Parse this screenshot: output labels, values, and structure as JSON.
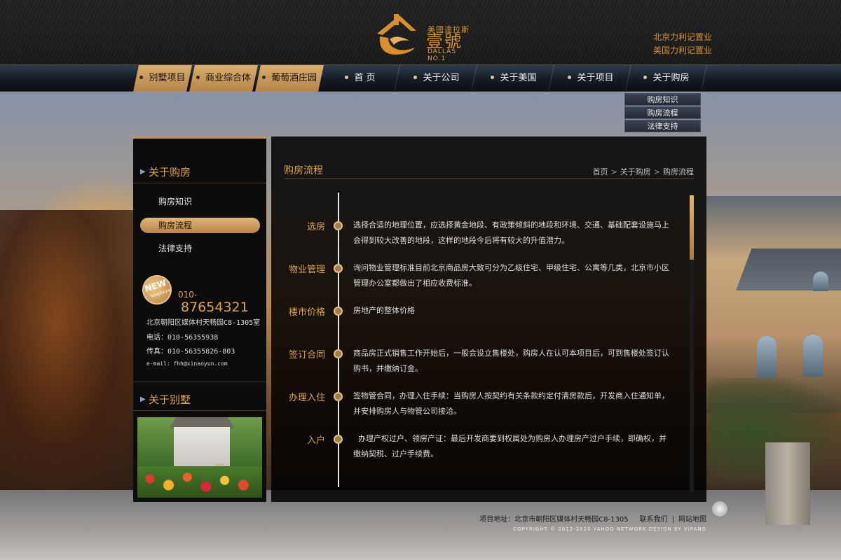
{
  "header": {
    "logo_sub": "美國達拉斯",
    "logo_main": "壹號",
    "logo_en": "DALLAS NO.1",
    "links": [
      "北京力利记置业",
      "美国力利记置业"
    ]
  },
  "nav": {
    "items": [
      "别墅项目",
      "商业综合体",
      "葡萄酒庄园",
      "首 页",
      "关于公司",
      "关于美国",
      "关于项目",
      "关于购房"
    ]
  },
  "dropdown": {
    "items": [
      "购房知识",
      "购房流程",
      "法律支持"
    ]
  },
  "sidebar": {
    "title": "关于购房",
    "menu": [
      "购房知识",
      "购房流程",
      "法律支持"
    ],
    "badge_new": "NEW",
    "badge_tel": "Telephone",
    "phone_prefix": "010-",
    "phone_number": "87654321",
    "address": "北京朝阳区媒体村天畅园C8-1305室",
    "tel": "电话：010-56355938",
    "fax": "传真：010-56355826-803",
    "email": "e-mail: fhh@xinaoyun.com",
    "villa_title": "关于别墅"
  },
  "main": {
    "title": "购房流程",
    "breadcrumb": [
      "首页",
      "关于购房",
      "购房流程"
    ],
    "steps": [
      {
        "label": "选房",
        "text": "选择合适的地理位置，应选择黄金地段、有政策倾斜的地段和环境、交通、基础配套设施马上会得到较大改善的地段，这样的地段今后将有较大的升值潜力。"
      },
      {
        "label": "物业管理",
        "text": "询问物业管理标准目前北京商品房大致可分为乙级住宅、甲级住宅、公寓等几类，北京市小区管理办公室都做出了相应收费标准。"
      },
      {
        "label": "楼市价格",
        "text": "房地产的整体价格"
      },
      {
        "label": "签订合同",
        "text": "商品房正式销售工作开始后，一般会设立售楼处，购房人在认可本项目后，可到售楼处签订认购书，并缴纳订金。"
      },
      {
        "label": "办理入住",
        "text": "签物管合同，办理入住手续：当购房人按契约有关条款约定付清房款后，开发商入住通知单，并安排购房人与物管公司接洽。"
      },
      {
        "label": "入户",
        "text": "  办理产权过户、领房产证：最后开发商要到权属处为购房人办理房产过户手续，即确权，并缴纳契税、过户手续费。"
      }
    ]
  },
  "footer": {
    "address": "项目地址：北京市朝阳区媒体村天畅园C8-1305",
    "contact": "联系我们",
    "sitemap": "网站地图",
    "copyright": "COPYRIGHT © 2012-2020 YAHOO NETWORK   DESIGN BY VIPANG"
  },
  "colors": {
    "gold": "#e0a24a",
    "nav_active": "#c79652",
    "panel": "#0c0c0c"
  }
}
